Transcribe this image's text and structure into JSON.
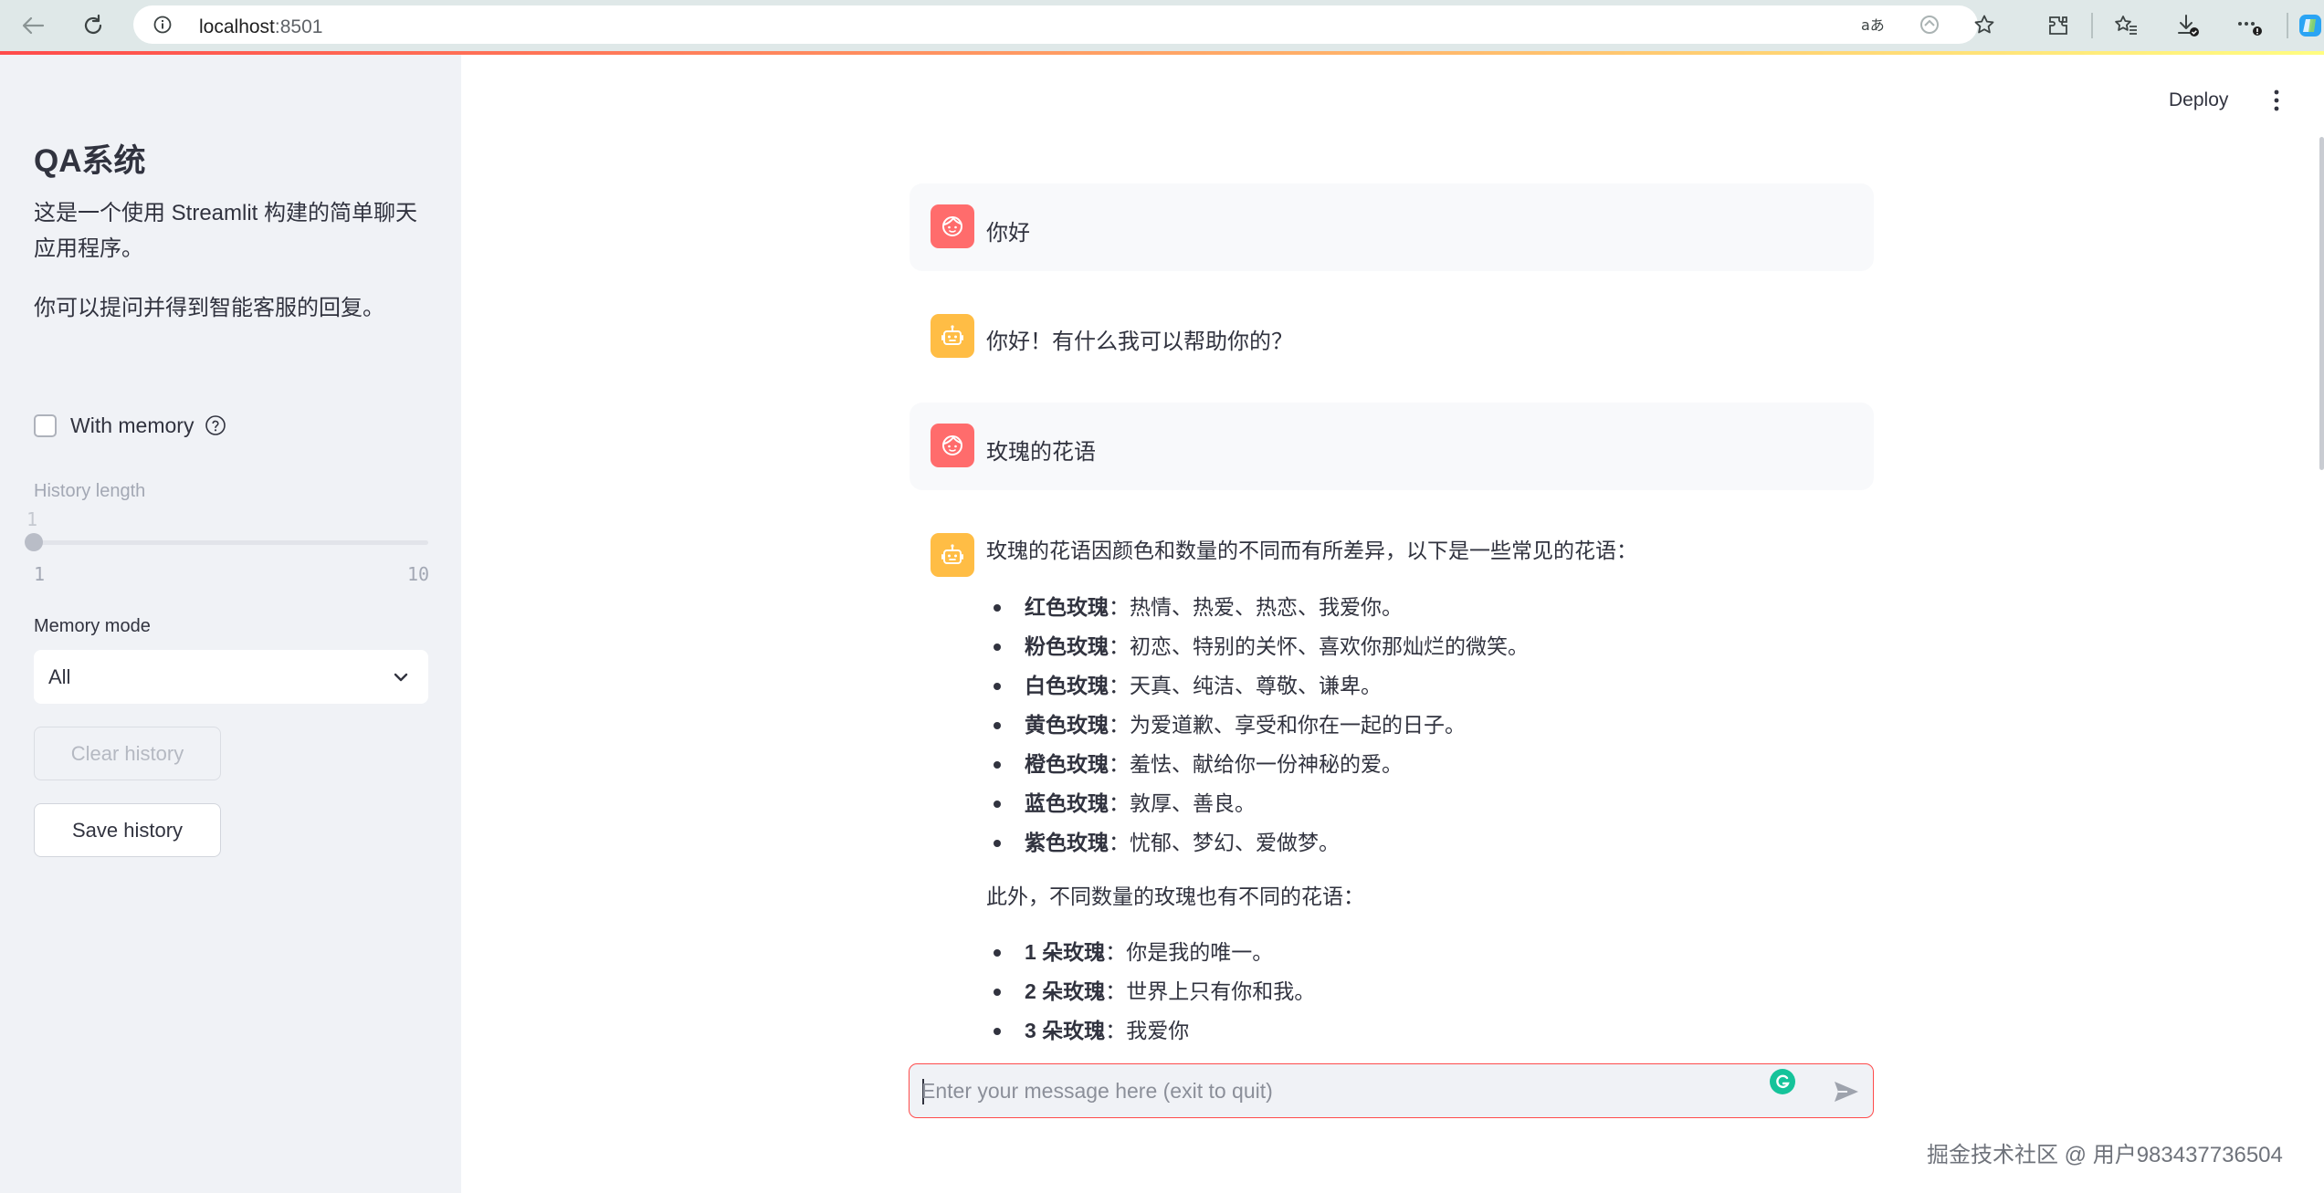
{
  "browser": {
    "url_host": "localhost",
    "url_port": ":8501"
  },
  "sidebar": {
    "title": "QA系统",
    "description": "这是一个使用 Streamlit 构建的简单聊天应用程序。",
    "description2": "你可以提问并得到智能客服的回复。",
    "memory_checkbox": {
      "label": "With memory",
      "checked": false
    },
    "history_slider": {
      "label": "History length",
      "value": "1",
      "min": "1",
      "max": "10"
    },
    "memory_mode": {
      "label": "Memory mode",
      "selected": "All"
    },
    "clear_button": "Clear history",
    "save_button": "Save history"
  },
  "header": {
    "deploy_label": "Deploy"
  },
  "chat": {
    "messages": [
      {
        "role": "user",
        "text": "你好"
      },
      {
        "role": "assistant",
        "text": "你好！有什么我可以帮助你的？"
      },
      {
        "role": "user",
        "text": "玫瑰的花语"
      }
    ],
    "answer": {
      "intro": "玫瑰的花语因颜色和数量的不同而有所差异，以下是一些常见的花语：",
      "colors": [
        {
          "term": "红色玫瑰",
          "desc": "：热情、热爱、热恋、我爱你。"
        },
        {
          "term": "粉色玫瑰",
          "desc": "：初恋、特别的关怀、喜欢你那灿烂的微笑。"
        },
        {
          "term": "白色玫瑰",
          "desc": "：天真、纯洁、尊敬、谦卑。"
        },
        {
          "term": "黄色玫瑰",
          "desc": "：为爱道歉、享受和你在一起的日子。"
        },
        {
          "term": "橙色玫瑰",
          "desc": "：羞怯、献给你一份神秘的爱。"
        },
        {
          "term": "蓝色玫瑰",
          "desc": "：敦厚、善良。"
        },
        {
          "term": "紫色玫瑰",
          "desc": "：忧郁、梦幻、爱做梦。"
        }
      ],
      "mid": "此外，不同数量的玫瑰也有不同的花语：",
      "counts": [
        {
          "term": "1 朵玫瑰",
          "desc": "：你是我的唯一。"
        },
        {
          "term": "2 朵玫瑰",
          "desc": "：世界上只有你和我。"
        },
        {
          "term": "3 朵玫瑰",
          "desc": "：我爱你"
        }
      ]
    },
    "input_placeholder": "Enter your message here (exit to quit)"
  },
  "watermark": "掘金技术社区 @ 用户983437736504",
  "colors": {
    "accent": "#ff4b4b",
    "user_avatar": "#ff6c6c",
    "bot_avatar": "#ffbd45",
    "sidebar_bg": "#f0f2f6"
  }
}
